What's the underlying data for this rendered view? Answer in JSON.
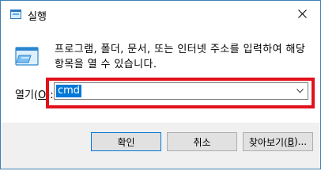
{
  "window": {
    "title": "실행",
    "icon": "run-dialog-icon",
    "border_color": "#3c7fb1"
  },
  "content": {
    "icon": "run-program-icon",
    "description": "프로그램, 폴더, 문서, 또는 인터넷 주소를 입력하여 해당 항목을 열 수 있습니다."
  },
  "open": {
    "label_prefix": "열기(",
    "label_mnemonic": "O",
    "label_suffix": "):",
    "value": "cmd",
    "highlight_color": "#e1121c",
    "selection_color": "#0078d7"
  },
  "buttons": {
    "ok": "확인",
    "cancel": "취소",
    "browse_prefix": "찾아보기(",
    "browse_mnemonic": "B",
    "browse_suffix": ")..."
  }
}
